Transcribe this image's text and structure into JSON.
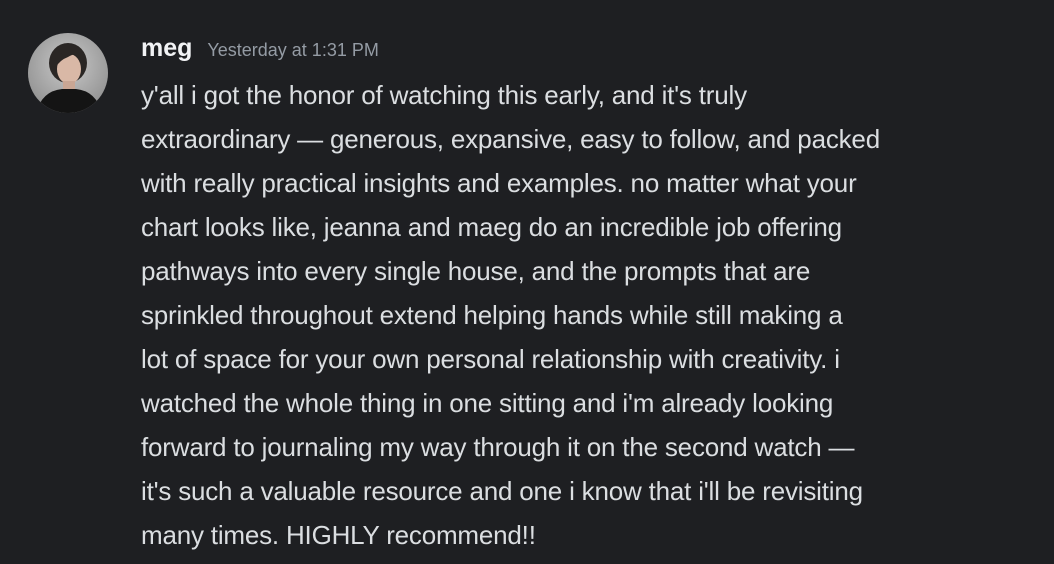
{
  "message": {
    "author": "meg",
    "timestamp": "Yesterday at 1:31 PM",
    "avatar_icon": "user-avatar-photo",
    "text_lines": [
      "y'all i got the honor of watching this early, and it's truly",
      "extraordinary — generous, expansive, easy to follow, and packed",
      "with really practical insights and examples. no matter what your",
      "chart looks like, jeanna and maeg do an incredible job offering",
      "pathways into every single house, and the prompts that are",
      "sprinkled throughout extend helping hands while still making a",
      "lot of space for your own personal relationship with creativity. i",
      "watched the whole thing in one sitting and i'm already looking",
      "forward to journaling my way through it on the second watch —",
      "it's such a valuable resource and one i know that i'll be revisiting",
      "many times. HIGHLY recommend!!"
    ]
  },
  "colors": {
    "background": "#1e1f22",
    "username": "#f2f3f5",
    "timestamp": "#949ba4",
    "text": "#dbdee1"
  }
}
